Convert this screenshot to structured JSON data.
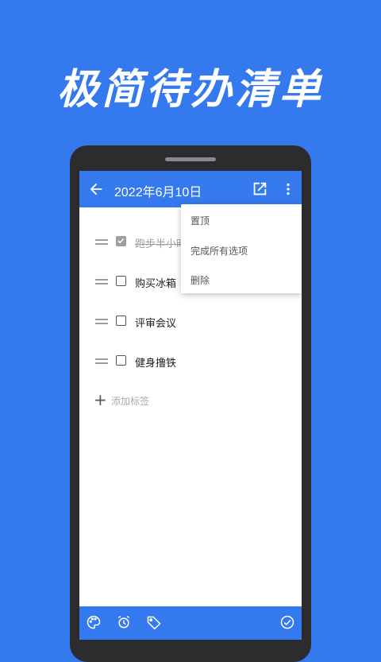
{
  "promo": {
    "title": "极简待办清单"
  },
  "app_bar": {
    "title": "2022年6月10日",
    "back_icon": "arrow-left-icon",
    "share_icon": "share-icon",
    "more_icon": "more-vert-icon"
  },
  "todos": [
    {
      "text": "跑步半小时",
      "done": true
    },
    {
      "text": "购买冰箱",
      "done": false
    },
    {
      "text": "评审会议",
      "done": false
    },
    {
      "text": "健身撸铁",
      "done": false
    }
  ],
  "add_tag": {
    "label": "添加标签"
  },
  "menu": {
    "items": [
      "置顶",
      "完成所有选项",
      "删除"
    ]
  },
  "bottom_bar": {
    "icons": [
      "palette-icon",
      "alarm-icon",
      "tag-icon",
      "check-circle-icon"
    ]
  },
  "colors": {
    "brand_blue": "#3579EE",
    "phone_frame": "#2C2C2E",
    "done_gray": "#9E9E9E"
  }
}
